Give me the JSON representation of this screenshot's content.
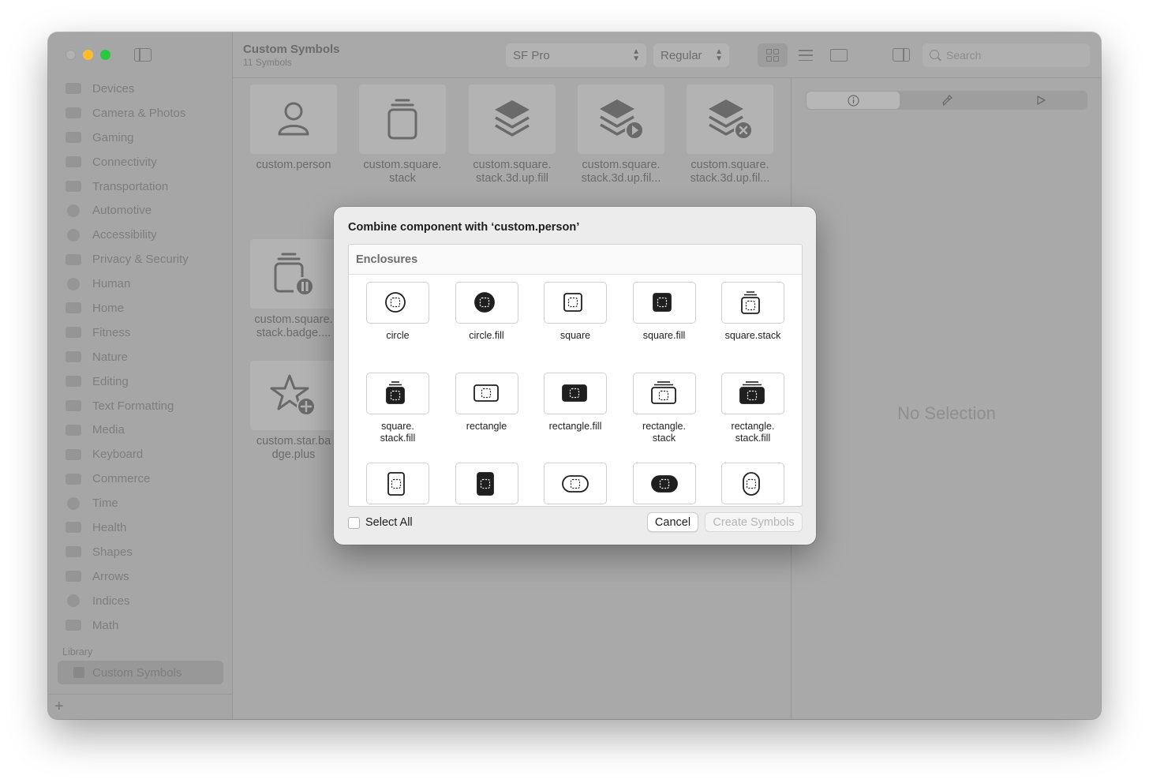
{
  "sidebar": {
    "items": [
      {
        "label": "Devices",
        "icon": "display-icon"
      },
      {
        "label": "Camera & Photos",
        "icon": "camera-icon"
      },
      {
        "label": "Gaming",
        "icon": "gamecontroller-icon"
      },
      {
        "label": "Connectivity",
        "icon": "antenna-icon"
      },
      {
        "label": "Transportation",
        "icon": "car-icon"
      },
      {
        "label": "Automotive",
        "icon": "steering-wheel-icon"
      },
      {
        "label": "Accessibility",
        "icon": "accessibility-icon"
      },
      {
        "label": "Privacy & Security",
        "icon": "lock-icon"
      },
      {
        "label": "Human",
        "icon": "person-circle-icon"
      },
      {
        "label": "Home",
        "icon": "house-icon"
      },
      {
        "label": "Fitness",
        "icon": "figure-run-icon"
      },
      {
        "label": "Nature",
        "icon": "leaf-icon"
      },
      {
        "label": "Editing",
        "icon": "slider-icon"
      },
      {
        "label": "Text Formatting",
        "icon": "textformat-icon"
      },
      {
        "label": "Media",
        "icon": "playpause-icon"
      },
      {
        "label": "Keyboard",
        "icon": "command-icon"
      },
      {
        "label": "Commerce",
        "icon": "cart-icon"
      },
      {
        "label": "Time",
        "icon": "clock-icon"
      },
      {
        "label": "Health",
        "icon": "heart-icon"
      },
      {
        "label": "Shapes",
        "icon": "shapes-icon"
      },
      {
        "label": "Arrows",
        "icon": "arrow-right-icon"
      },
      {
        "label": "Indices",
        "icon": "a-circle-icon"
      },
      {
        "label": "Math",
        "icon": "function-icon"
      }
    ],
    "library_header": "Library",
    "library_selected": "Custom Symbols",
    "add_label": "+"
  },
  "toolbar": {
    "title": "Custom Symbols",
    "subtitle": "11 Symbols",
    "font_popup": "SF Pro",
    "weight_popup": "Regular",
    "search_placeholder": "Search"
  },
  "symbols": [
    {
      "label": "custom.person"
    },
    {
      "label": "custom.square.\nstack"
    },
    {
      "label": "custom.square.\nstack.3d.up.fill"
    },
    {
      "label": "custom.square.\nstack.3d.up.fil..."
    },
    {
      "label": "custom.square.\nstack.3d.up.fil..."
    },
    {
      "label": "custom.square.\nstack.badge...."
    },
    {
      "label": "custom.star.ba\ndge.plus"
    }
  ],
  "inspector": {
    "empty_text": "No Selection"
  },
  "dialog": {
    "title": "Combine component with ‘custom.person’",
    "section_header": "Enclosures",
    "enclosures": [
      {
        "label": "circle",
        "shape": "circle",
        "fill": false
      },
      {
        "label": "circle.fill",
        "shape": "circle",
        "fill": true
      },
      {
        "label": "square",
        "shape": "square",
        "fill": false
      },
      {
        "label": "square.fill",
        "shape": "square",
        "fill": true
      },
      {
        "label": "square.stack",
        "shape": "square-stack",
        "fill": false
      },
      {
        "label": "square.\nstack.fill",
        "shape": "square-stack",
        "fill": true
      },
      {
        "label": "rectangle",
        "shape": "rectangle",
        "fill": false
      },
      {
        "label": "rectangle.fill",
        "shape": "rectangle",
        "fill": true
      },
      {
        "label": "rectangle.\nstack",
        "shape": "rectangle-stack",
        "fill": false
      },
      {
        "label": "rectangle.\nstack.fill",
        "shape": "rectangle-stack",
        "fill": true
      },
      {
        "label": "",
        "shape": "portrait",
        "fill": false
      },
      {
        "label": "",
        "shape": "portrait",
        "fill": true
      },
      {
        "label": "",
        "shape": "capsule",
        "fill": false
      },
      {
        "label": "",
        "shape": "capsule",
        "fill": true
      },
      {
        "label": "",
        "shape": "capsule-portrait",
        "fill": false
      }
    ],
    "select_all_label": "Select All",
    "cancel_label": "Cancel",
    "create_label": "Create Symbols"
  }
}
